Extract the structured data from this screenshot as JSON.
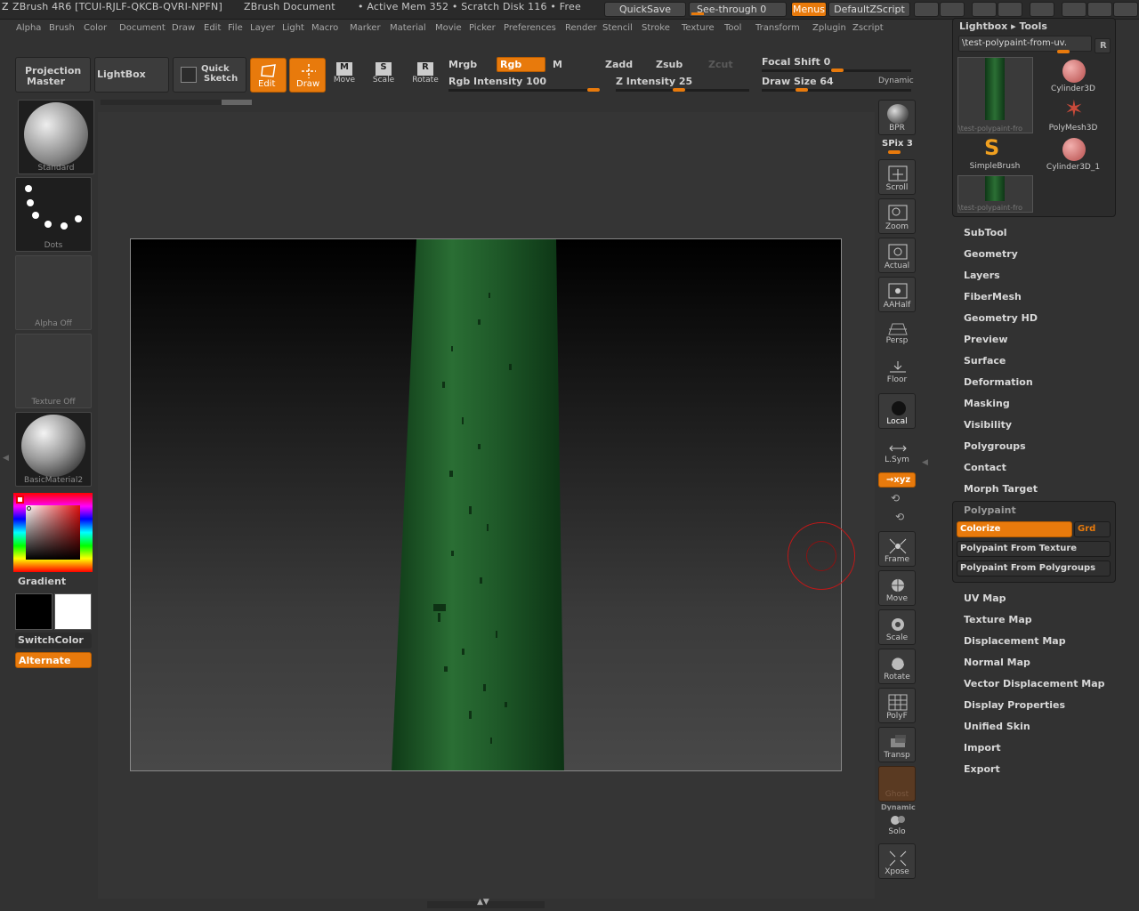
{
  "titlebar": {
    "app": "ZBrush 4R6 [TCUI-RJLF-QKCB-QVRI-NPFN]",
    "document": "ZBrush Document",
    "mem": "• Active Mem 352 • Scratch Disk 116 • Free",
    "quicksave": "QuickSave",
    "seethrough": "See-through  0",
    "menus": "Menus",
    "defaultzscript": "DefaultZScript"
  },
  "menu": [
    "Alpha",
    "Brush",
    "Color",
    "Document",
    "Draw",
    "Edit",
    "File",
    "Layer",
    "Light",
    "Macro",
    "Marker",
    "Material",
    "Movie",
    "Picker",
    "Preferences",
    "Render",
    "Stencil",
    "Stroke",
    "Texture",
    "Tool",
    "Transform",
    "Zplugin",
    "Zscript"
  ],
  "shelf": {
    "projection_master": [
      "Projection",
      "Master"
    ],
    "lightbox": "LightBox",
    "quick_sketch": [
      "Quick",
      "Sketch"
    ],
    "edit": "Edit",
    "draw": "Draw",
    "move": "Move",
    "scale": "Scale",
    "rotate": "Rotate",
    "mrgb": "Mrgb",
    "rgb": "Rgb",
    "m": "M",
    "zadd": "Zadd",
    "zsub": "Zsub",
    "zcut": "Zcut",
    "rgb_intensity": "Rgb  Intensity 100",
    "z_intensity": "Z  Intensity 25",
    "focal_shift": "Focal  Shift 0",
    "draw_size": "Draw  Size 64",
    "dynamic": "Dynamic",
    "rgb_intensity_value": 100,
    "z_intensity_value": 25,
    "focal_shift_value": 0,
    "draw_size_value": 64
  },
  "left": {
    "brush": "Standard",
    "stroke": "Dots",
    "alpha": "Alpha  Off",
    "texture": "Texture  Off",
    "material": "BasicMaterial2",
    "gradient": "Gradient",
    "switchcolor": "SwitchColor",
    "alternate": "Alternate"
  },
  "right_toolbar": {
    "bpr": "BPR",
    "spix": "SPix 3",
    "scroll": "Scroll",
    "zoom": "Zoom",
    "actual": "Actual",
    "aahalf": "AAHalf",
    "persp": "Persp",
    "floor": "Floor",
    "local": "Local",
    "lsym": "L.Sym",
    "xyz": "→xyz",
    "frame": "Frame",
    "move": "Move",
    "scale": "Scale",
    "rotate": "Rotate",
    "polyf": "PolyF",
    "transp": "Transp",
    "ghost": "Ghost",
    "dynamic": "Dynamic",
    "solo": "Solo",
    "xpose": "Xpose"
  },
  "tool_palette": {
    "header": "Lightbox ▸ Tools",
    "current_tool": "\\test-polypaint-from-uv.",
    "r_button": "R",
    "tools": [
      {
        "name": "\\test-polypaint-fro"
      },
      {
        "name": "Cylinder3D"
      },
      {
        "name": "PolyMesh3D"
      },
      {
        "name": "SimpleBrush"
      },
      {
        "name": "Cylinder3D_1"
      },
      {
        "name": "\\test-polypaint-fro"
      }
    ],
    "sections": [
      "SubTool",
      "Geometry",
      "Layers",
      "FiberMesh",
      "Geometry HD",
      "Preview",
      "Surface",
      "Deformation",
      "Masking",
      "Visibility",
      "Polygroups",
      "Contact",
      "Morph Target"
    ],
    "polypaint": {
      "title": "Polypaint",
      "colorize": "Colorize",
      "grd": "Grd",
      "from_texture": "Polypaint From Texture",
      "from_polygroups": "Polypaint From Polygroups"
    },
    "sections2": [
      "UV Map",
      "Texture Map",
      "Displacement Map",
      "Normal Map",
      "Vector Displacement Map",
      "Display Properties",
      "Unified Skin",
      "Import",
      "Export"
    ]
  },
  "colors": {
    "accent": "#e87a0c",
    "mesh": "#1d5a2a"
  }
}
